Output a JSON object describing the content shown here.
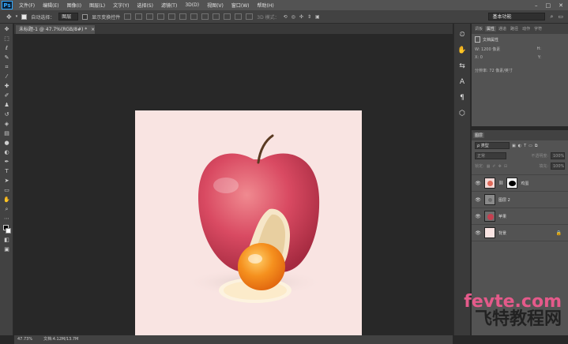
{
  "app": {
    "logo": "Ps"
  },
  "menu": [
    "文件(F)",
    "编辑(E)",
    "图像(I)",
    "图层(L)",
    "文字(Y)",
    "选择(S)",
    "滤镜(T)",
    "3D(D)",
    "视图(V)",
    "窗口(W)",
    "帮助(H)"
  ],
  "window_controls": [
    "–",
    "□",
    "✕"
  ],
  "options": {
    "auto_select_label": "自动选择：",
    "auto_select_value": "图层",
    "show_transform_label": "显示变换控件",
    "mode_3d_label": "3D 模式：",
    "workspace": "基本功能"
  },
  "tools": [
    "move-icon",
    "marquee-icon",
    "lasso-icon",
    "quick-select-icon",
    "crop-icon",
    "eyedropper-icon",
    "healing-icon",
    "brush-icon",
    "stamp-icon",
    "history-brush-icon",
    "eraser-icon",
    "gradient-icon",
    "blur-icon",
    "dodge-icon",
    "pen-icon",
    "type-icon",
    "path-select-icon",
    "shape-icon",
    "hand-icon",
    "zoom-icon",
    "more-icon",
    "swap-colors-icon",
    "quick-mask-icon",
    "screen-mode-icon"
  ],
  "document": {
    "tab_label": "未标题-1 @ 47.7%(RGB/8#) *",
    "tab_close": "×"
  },
  "status": {
    "zoom": "47.73%",
    "doc_size": "文档:4.12M/13.7M"
  },
  "properties": {
    "tabs": [
      "调板",
      "属性",
      "通道",
      "路径",
      "动作",
      "字符"
    ],
    "active_tab": "属性",
    "title": "文档属性",
    "w_label": "W:",
    "w_value": "1200 像素",
    "h_label": "H:",
    "x_label": "X:",
    "x_value": "0",
    "y_label": "Y:",
    "resolution": "分辨率: 72 像素/英寸"
  },
  "layers": {
    "tabs": [
      "图层"
    ],
    "filter_kind": "ρ 类型",
    "blend_mode": "正常",
    "opacity_label": "不透明度:",
    "opacity_value": "100%",
    "lock_label": "锁定:",
    "fill_label": "填充:",
    "fill_value": "100%",
    "items": [
      {
        "name": "鸡蛋",
        "thumb": "#e06a5a",
        "has_mask": true,
        "locked": false
      },
      {
        "name": "图层 2",
        "thumb": "#8a8a8a",
        "has_mask": false,
        "locked": false
      },
      {
        "name": "苹果",
        "thumb": "#c44050",
        "has_mask": false,
        "locked": false
      },
      {
        "name": "背景",
        "thumb": "#f9e4e2",
        "has_mask": false,
        "locked": true
      }
    ]
  },
  "watermark": {
    "line1": "fevte.com",
    "line2": "飞特教程网"
  },
  "colors": {
    "canvas_bg": "#f9e4e2",
    "apple": "#d04a5e",
    "yolk": "#f28a1e"
  }
}
